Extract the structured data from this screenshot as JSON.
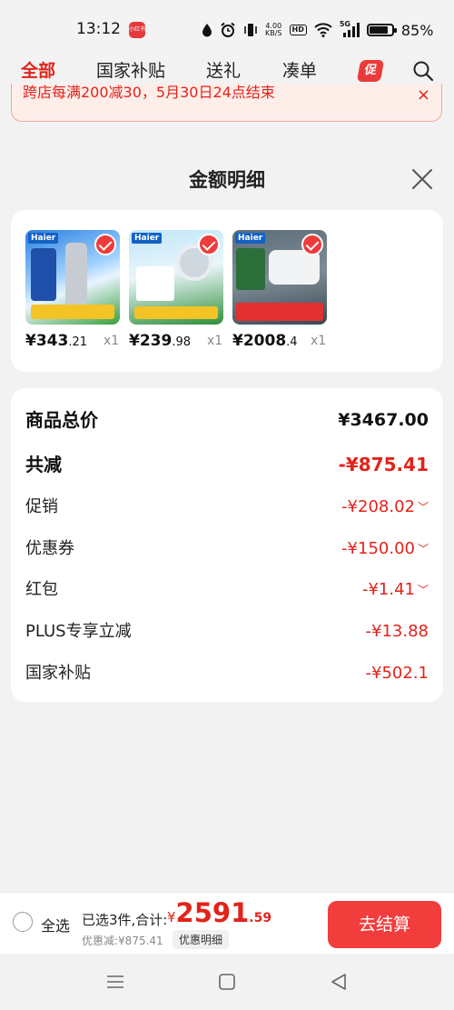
{
  "status": {
    "time": "13:12",
    "app_icon_text": "小红书",
    "net_speed_value": "4.00",
    "net_speed_unit": "KB/S",
    "hd_label": "HD",
    "network_label": "5G",
    "battery_level": 0.85,
    "battery_pct": "85%"
  },
  "tabs": [
    {
      "label": "全部",
      "active": true
    },
    {
      "label": "国家补贴",
      "active": false
    },
    {
      "label": "送礼",
      "active": false
    },
    {
      "label": "凑单",
      "active": false
    }
  ],
  "promo_tab_label": "促",
  "banner": {
    "text": "跨店每满200减30，5月30日24点结束",
    "close_icon": "×"
  },
  "sheet": {
    "title": "金额明细",
    "close_icon": "close-icon"
  },
  "products": [
    {
      "brand": "Haier",
      "price_int": "¥343",
      "price_dec": ".21",
      "qty": "x1"
    },
    {
      "brand": "Haier",
      "price_int": "¥239",
      "price_dec": ".98",
      "qty": "x1"
    },
    {
      "brand": "Haier",
      "price_int": "¥2008",
      "price_dec": ".4",
      "qty": "x1"
    }
  ],
  "details": {
    "total_label": "商品总价",
    "total_value": "¥3467.00",
    "reduce_label": "共减",
    "reduce_value": "-¥875.41",
    "items": [
      {
        "label": "促销",
        "value": "-¥208.02",
        "expandable": true
      },
      {
        "label": "优惠券",
        "value": "-¥150.00",
        "expandable": true
      },
      {
        "label": "红包",
        "value": "-¥1.41",
        "expandable": true
      },
      {
        "label": "PLUS专享立减",
        "value": "-¥13.88",
        "expandable": false
      },
      {
        "label": "国家补贴",
        "value": "-¥502.1",
        "expandable": false
      }
    ],
    "chevron": "﹀"
  },
  "bottom": {
    "select_all": "全选",
    "summary": "已选3件,合计:",
    "currency": "¥",
    "total_int": "2591",
    "total_dec": ".59",
    "saved": "优惠减:¥875.41",
    "detail_button": "优惠明细",
    "checkout": "去结算"
  },
  "colors": {
    "accent": "#e2231a",
    "checkout": "#f23d3d"
  }
}
